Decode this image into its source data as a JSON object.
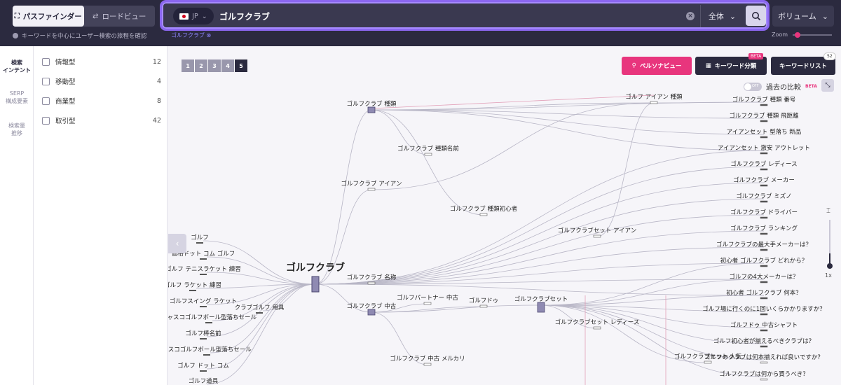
{
  "header": {
    "mode_tabs": [
      {
        "label": "パスファインダー",
        "active": true
      },
      {
        "label": "ロードビュー",
        "active": false
      }
    ],
    "hint": "キーワードを中心にユーザー検索の旅程を確認",
    "search": {
      "country": "JP",
      "query": "ゴルフクラブ",
      "scope": "全体"
    },
    "volume_label": "ボリューム",
    "breadcrumb": "ゴルフクラブ",
    "zoom_label": "Zoom",
    "zoom_level": 0.05
  },
  "leftnav": [
    {
      "label": "検索\nインテント",
      "active": true
    },
    {
      "label": "SERP\n構成要素",
      "active": false
    },
    {
      "label": "検索量\n推移",
      "active": false
    }
  ],
  "filters": [
    {
      "label": "情報型",
      "count": "12"
    },
    {
      "label": "移動型",
      "count": "4"
    },
    {
      "label": "商業型",
      "count": "8"
    },
    {
      "label": "取引型",
      "count": "42"
    }
  ],
  "toolbar": {
    "pages": [
      "1",
      "2",
      "3",
      "4",
      "5"
    ],
    "active_page": "5",
    "persona_label": "ペルソナビュー",
    "classify_label": "キーワード分類",
    "classify_badge": "BETA",
    "list_label": "キーワードリスト",
    "list_count": "52",
    "compare_label": "過去の比較",
    "compare_toggle": "OFF",
    "compare_badge": "BETA",
    "depth_label": "1x"
  },
  "colors": {
    "accent": "#e8357d",
    "dark": "#2b2a3f",
    "search_border": "#8b67f0",
    "node": "#8f8ab2"
  },
  "graph": {
    "root": "ゴルフクラブ",
    "left_nodes": [
      "ゴルフ",
      "価格ドット コム ゴルフ",
      "ゴルフ テニスラケット 練習",
      "ゴルフ ラケット 練習",
      "ゴルフスイング ラケット",
      "クラブゴルフ 用具",
      "キャスコゴルフボール型落ちセール",
      "ゴルフ棒名前",
      "ャスコゴルフボール型落ちセール",
      "ゴルフ ドット コム",
      "ゴルフ道具"
    ],
    "mid_nodes": [
      "ゴルフクラブ 種類",
      "ゴルフクラブ 種類名前",
      "ゴルフクラブ アイアン",
      "ゴルフクラブ 種類初心者",
      "ゴルフ アイアン 種類",
      "ゴルフクラブセット アイアン",
      "ゴルフクラブ 名称",
      "ゴルフクラブ 中古",
      "ゴルフパートナー 中古",
      "ゴルフドゥ",
      "ゴルフクラブセット",
      "ゴルフクラブセット レディース",
      "ゴルフクラブ 中古 メルカリ",
      "ゴルフクラブセット 人気"
    ],
    "right_nodes": [
      "ゴルフクラブ 種類 番号",
      "ゴルフクラブ 種類 飛距離",
      "アイアンセット 型落ち 新品",
      "アイアンセット 激安 アウトレット",
      "ゴルフクラブ レディース",
      "ゴルフクラブ メーカー",
      "ゴルフクラブ ミズノ",
      "ゴルフクラブ ドライバー",
      "ゴルフクラブ ランキング",
      "ゴルフクラブの最大手メーカーは？",
      "初心者 ゴルフクラブ どれから？",
      "ゴルフの4大メーカーは？",
      "初心者 ゴルフクラブ 何本？",
      "ゴルフ場に行くのに1回いくらかかりますか？",
      "ゴルフドゥ 中古シャフト",
      "ゴルフ初心者が揃えるべきクラブは？",
      "ゴルフのクラブは何本揃えれば良いですか？",
      "ゴルフクラブは何から買うべき？"
    ]
  }
}
